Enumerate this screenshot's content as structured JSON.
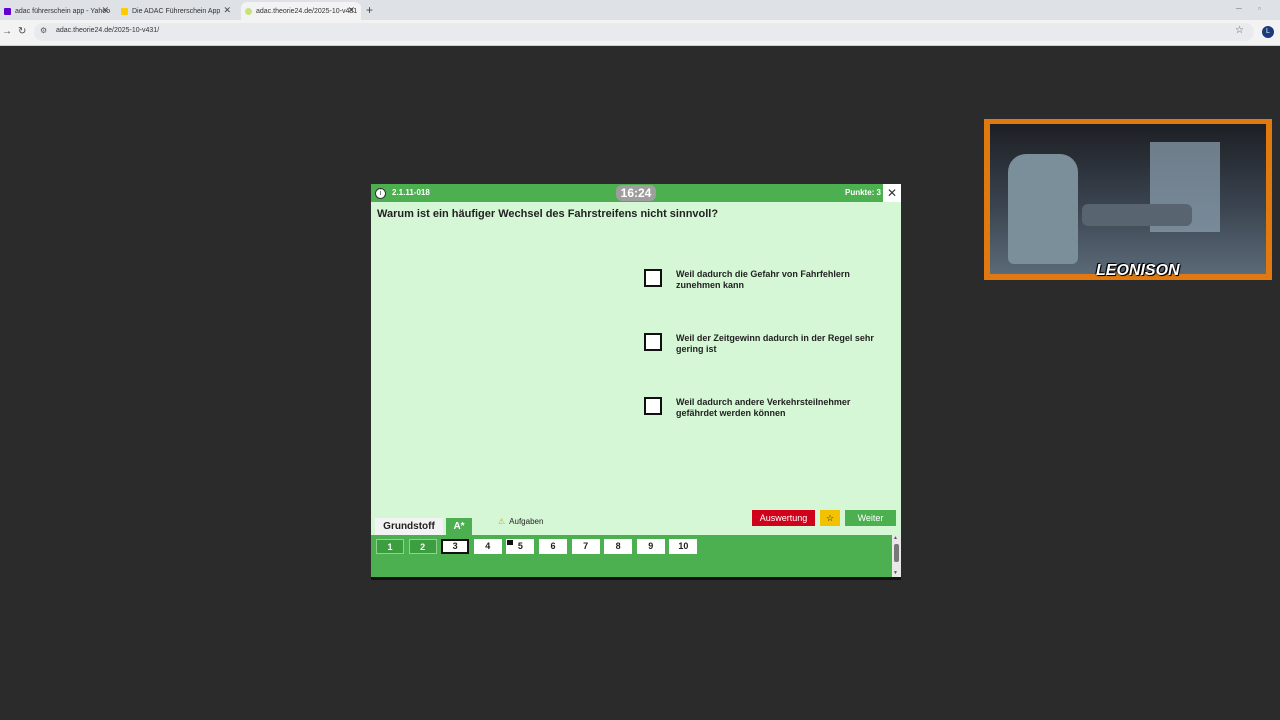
{
  "browser": {
    "tabs": [
      {
        "title": "adac führerschein app - Yahoo",
        "favicon_color": "#6001d2"
      },
      {
        "title": "Die ADAC Führerschein App",
        "favicon_color": "#ffcc00"
      },
      {
        "title": "adac.theorie24.de/2025-10-v431",
        "favicon_color": "#c8e27a"
      }
    ],
    "new_tab": "+",
    "url": "adac.theorie24.de/2025-10-v431/",
    "profile_initial": "L"
  },
  "quiz": {
    "question_id": "2.1.11-018",
    "timer": "16:24",
    "points": "Punkte: 3",
    "question": "Warum ist ein häufiger Wechsel des Fahrstreifens nicht sinnvoll?",
    "answers": [
      {
        "text": "Weil dadurch die Gefahr von Fahrfehlern zunehmen kann",
        "checked": false
      },
      {
        "text": "Weil der Zeitgewinn dadurch in der Regel sehr gering ist",
        "checked": false
      },
      {
        "text": "Weil dadurch andere Verkehrsteilnehmer gefährdet werden können",
        "checked": false
      }
    ],
    "tab_grundstoff": "Grundstoff",
    "tab_class": "A*",
    "aufgaben_label": "Aufgaben",
    "btn_auswertung": "Auswertung",
    "btn_star": "☆",
    "btn_weiter": "Weiter",
    "numbers": [
      "1",
      "2",
      "3",
      "4",
      "5",
      "6",
      "7",
      "8",
      "9",
      "10"
    ],
    "answered": [
      1,
      2
    ],
    "current": 3,
    "flagged": [
      5
    ]
  },
  "webcam": {
    "logo_text": "LEONISON"
  },
  "colors": {
    "quiz_green": "#4caf50",
    "quiz_bg": "#d6f7d6",
    "auswertung_red": "#d0021b",
    "star_yellow": "#f2c200"
  }
}
